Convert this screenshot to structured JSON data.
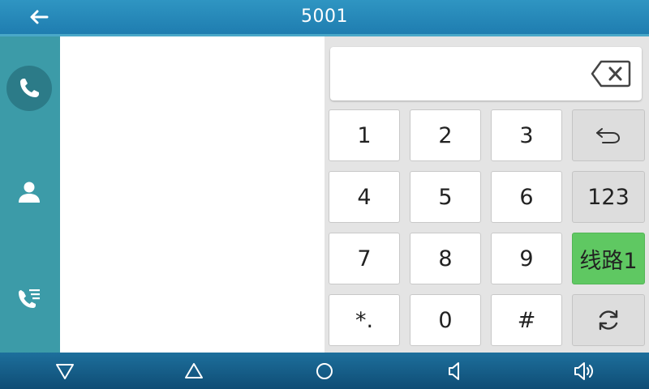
{
  "header": {
    "title": "5001",
    "back_icon": "arrow-left-icon"
  },
  "sidebar": {
    "items": [
      {
        "icon": "phone-icon",
        "active": true
      },
      {
        "icon": "contact-icon",
        "active": false
      },
      {
        "icon": "call-history-icon",
        "active": false
      }
    ]
  },
  "dialer": {
    "number_value": "",
    "keys": [
      "1",
      "2",
      "3",
      "4",
      "5",
      "6",
      "7",
      "8",
      "9",
      "*.",
      "0",
      "#"
    ],
    "function_keys": {
      "undo_icon": "undo-icon",
      "input_mode": "123",
      "line": "线路1",
      "switch_icon": "refresh-icon"
    },
    "line_color": "#5fc862"
  },
  "navbar": {
    "icons": [
      "back-triangle-icon",
      "home-triangle-icon",
      "circle-icon",
      "volume-down-icon",
      "volume-up-icon"
    ]
  },
  "colors": {
    "topbar": "#2f95c2",
    "sidebar": "#3c9ba8",
    "navbar": "#1d6f9c"
  }
}
